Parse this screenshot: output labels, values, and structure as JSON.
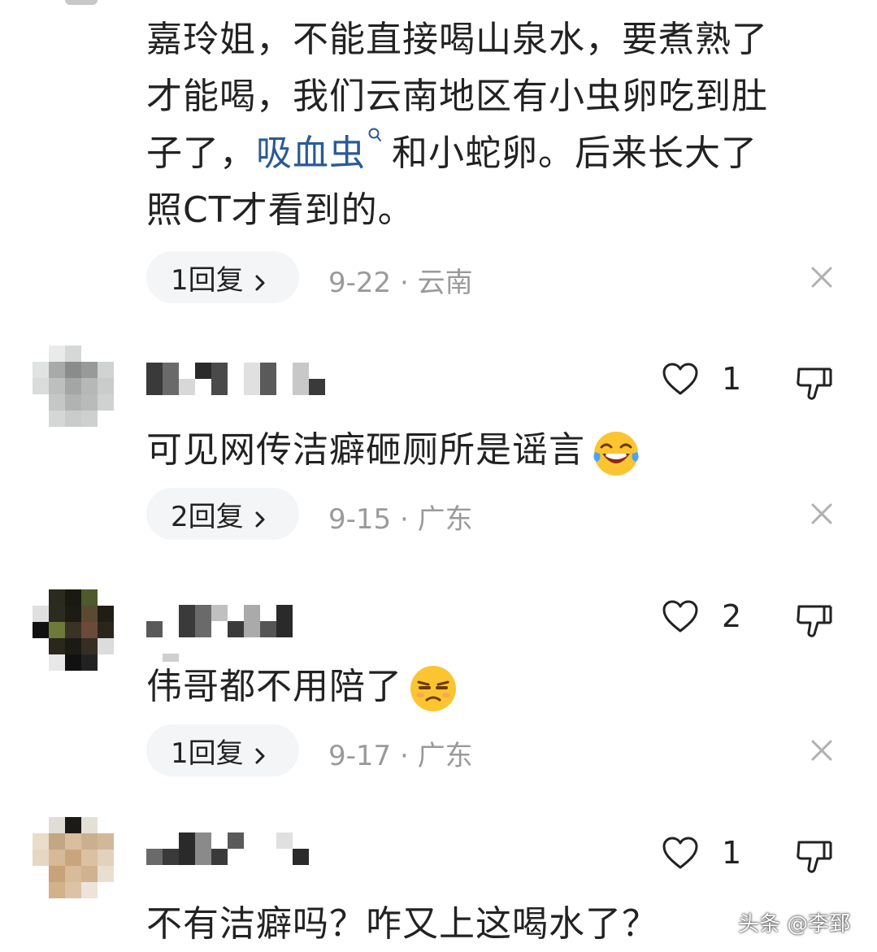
{
  "top_comment": {
    "lines": [
      "嘉玲姐，不能直接喝山泉水，要煮熟了",
      "才能喝，我们云南地区有小虫卵吃到肚"
    ],
    "line3_prefix": "子了，",
    "line3_link": "吸血虫",
    "line3_suffix": "和小蛇卵。后来长大了",
    "line4": "照CT才看到的。",
    "replies_label": "1回复",
    "meta": "9-22 · 云南"
  },
  "comments": [
    {
      "text": "可见网传洁癖砸厕所是谣言",
      "emoji": "laugh-cry-emoji",
      "likes": "1",
      "replies_label": "2回复",
      "meta": "9-15 · 广东"
    },
    {
      "text": "伟哥都不用陪了",
      "emoji": "unamused-emoji",
      "likes": "2",
      "replies_label": "1回复",
      "meta": "9-17 · 广东"
    },
    {
      "text": "不有洁癖吗？咋又上这喝水了？",
      "likes": "1"
    }
  ],
  "watermark": "头条 @李郅",
  "colors": {
    "link": "#2a5a96",
    "meta": "#9a9a9a",
    "pill_bg": "#f4f5f7",
    "text": "#222222"
  }
}
